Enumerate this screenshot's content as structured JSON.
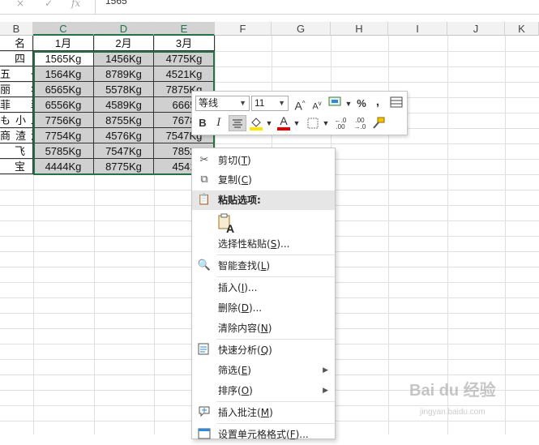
{
  "formula_bar": {
    "cancel_icon": "×",
    "confirm_icon": "✓",
    "fx_label": "fx",
    "value": "1565"
  },
  "columns": [
    "B",
    "C",
    "D",
    "E",
    "F",
    "G",
    "H",
    "I",
    "J",
    "K"
  ],
  "header_row": {
    "name": "名",
    "m1": "1月",
    "m2": "2月",
    "m3": "3月"
  },
  "rows": [
    {
      "name": "四",
      "c": "1565Kg",
      "d": "1456Kg",
      "e": "4775Kg"
    },
    {
      "name": "五　一",
      "c": "1564Kg",
      "d": "8789Kg",
      "e": "4521Kg"
    },
    {
      "name": "丽　华",
      "c": "6565Kg",
      "d": "5578Kg",
      "e": "7875Kg"
    },
    {
      "name": "菲　菲",
      "c": "6556Kg",
      "d": "4589Kg",
      "e": "6665"
    },
    {
      "name": "も小二",
      "c": "7756Kg",
      "d": "8755Kg",
      "e": "7678"
    },
    {
      "name": "商渣渣",
      "c": "7754Kg",
      "d": "4576Kg",
      "e": "7547Kg"
    },
    {
      "name": "飞",
      "c": "5785Kg",
      "d": "7547Kg",
      "e": "7852"
    },
    {
      "name": "宝",
      "c": "4444Kg",
      "d": "8775Kg",
      "e": "4541"
    }
  ],
  "mini_toolbar": {
    "font_name": "等线",
    "font_size": "11",
    "grow_font": "A",
    "shrink_font": "A",
    "percent": "%",
    "comma": ",",
    "bold": "B",
    "italic": "I",
    "font_color_letter": "A",
    "increase_decimal": "←.0\n.00",
    "decrease_decimal": ".00\n→.0"
  },
  "context_menu": {
    "items": [
      {
        "label": "剪切",
        "key": "T"
      },
      {
        "label": "复制",
        "key": "C"
      },
      {
        "label": "粘贴选项:"
      },
      {
        "label": "选择性粘贴",
        "key": "S",
        "suffix": "..."
      },
      {
        "label": "智能查找",
        "key": "L"
      },
      {
        "label": "插入",
        "key": "I",
        "suffix": "..."
      },
      {
        "label": "删除",
        "key": "D",
        "suffix": "..."
      },
      {
        "label": "清除内容",
        "key": "N"
      },
      {
        "label": "快速分析",
        "key": "Q"
      },
      {
        "label": "筛选",
        "key": "E"
      },
      {
        "label": "排序",
        "key": "O"
      },
      {
        "label": "插入批注",
        "key": "M"
      },
      {
        "label": "设置单元格格式",
        "key": "F",
        "suffix": "..."
      }
    ]
  },
  "watermark": {
    "main": "Bai du 经验",
    "sub": "jingyan.baidu.com"
  },
  "colors": {
    "accent": "#217346",
    "selection": "#d0d0d0",
    "font_color_bar": "#e00000",
    "fill_color_bar": "#ffe600"
  }
}
